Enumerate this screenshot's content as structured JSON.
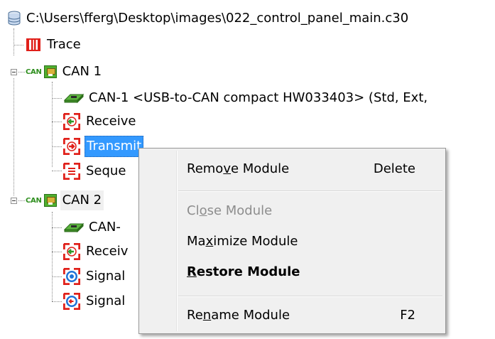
{
  "tree": {
    "root_path": "C:\\Users\\fferg\\Desktop\\images\\022_control_panel_main.c30",
    "trace_label": "Trace",
    "can1": {
      "tag": "CAN",
      "label": "CAN 1",
      "device_label": "CAN-1  <USB-to-CAN compact HW033403>  (Std, Ext,",
      "receive_label": "Receive",
      "transmit_label": "Transmit",
      "sequence_label": "Seque"
    },
    "can2": {
      "tag": "CAN",
      "label": "CAN 2",
      "device_label": "CAN-",
      "receive_label": "Receiv",
      "signal1_label": "Signal",
      "signal2_label": "Signal"
    }
  },
  "context_menu": {
    "items": [
      {
        "pre": "Remo",
        "accel": "v",
        "post": "e Module",
        "shortcut": "Delete",
        "enabled": true,
        "bold": false
      },
      {
        "pre": "Cl",
        "accel": "o",
        "post": "se Module",
        "shortcut": "",
        "enabled": false,
        "bold": false
      },
      {
        "pre": "Ma",
        "accel": "x",
        "post": "imize Module",
        "shortcut": "",
        "enabled": true,
        "bold": false
      },
      {
        "pre": "",
        "accel": "R",
        "post": "estore Module",
        "shortcut": "",
        "enabled": true,
        "bold": true
      },
      {
        "pre": "Re",
        "accel": "n",
        "post": "ame Module",
        "shortcut": "F2",
        "enabled": true,
        "bold": false
      }
    ]
  },
  "colors": {
    "selection": "#3399ff",
    "menu_background": "#f0f0f0",
    "disabled_text": "#8d8d8d",
    "module_icon_red": "#e0201a",
    "signal_icon_blue": "#1e73d8",
    "can_green": "#4fb02f"
  },
  "icons": {
    "root": "database-icon",
    "trace": "trace-icon",
    "can_bus": "can-bus-icon",
    "device": "usb-can-device-icon",
    "receive": "receive-module-icon",
    "transmit": "transmit-module-icon",
    "sequence": "sequence-module-icon",
    "signal": "signal-module-icon"
  }
}
